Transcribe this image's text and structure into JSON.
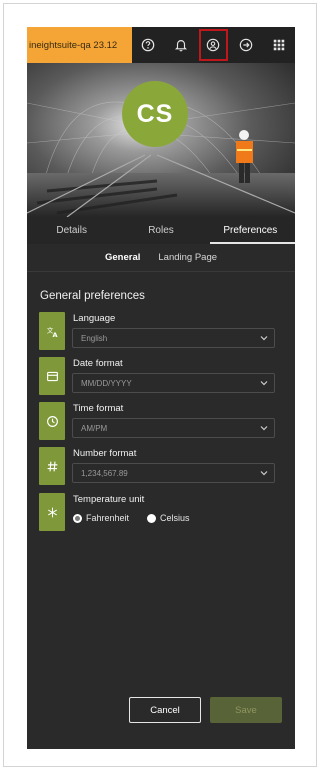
{
  "topbar": {
    "app_label": "ineightsuite-qa 23.12",
    "icons": [
      "help-icon",
      "bell-icon",
      "user-profile-icon",
      "logout-icon",
      "apps-grid-icon"
    ],
    "active_icon": "user-profile-icon",
    "badge_color": "#f4a535"
  },
  "profile": {
    "initials": "CS",
    "avatar_color": "#8aa83a"
  },
  "tabs": [
    {
      "label": "Details"
    },
    {
      "label": "Roles"
    },
    {
      "label": "Preferences",
      "active": true
    }
  ],
  "subtabs": [
    {
      "label": "General",
      "active": true
    },
    {
      "label": "Landing Page"
    }
  ],
  "section_title": "General preferences",
  "preferences": {
    "language": {
      "label": "Language",
      "value": "English",
      "icon": "translate-icon"
    },
    "date_format": {
      "label": "Date format",
      "value": "MM/DD/YYYY",
      "icon": "calendar-icon"
    },
    "time_format": {
      "label": "Time format",
      "value": "AM/PM",
      "icon": "clock-icon"
    },
    "number_format": {
      "label": "Number format",
      "value": "1,234,567.89",
      "icon": "hash-icon"
    },
    "temperature": {
      "label": "Temperature unit",
      "icon": "snowflake-icon",
      "options": [
        "Fahrenheit",
        "Celsius"
      ],
      "selected": "Fahrenheit"
    }
  },
  "actions": {
    "cancel_label": "Cancel",
    "save_label": "Save"
  },
  "colors": {
    "accent_green": "#7f993a",
    "panel_bg": "#2a2a2a",
    "highlight_red": "#c0171c"
  }
}
